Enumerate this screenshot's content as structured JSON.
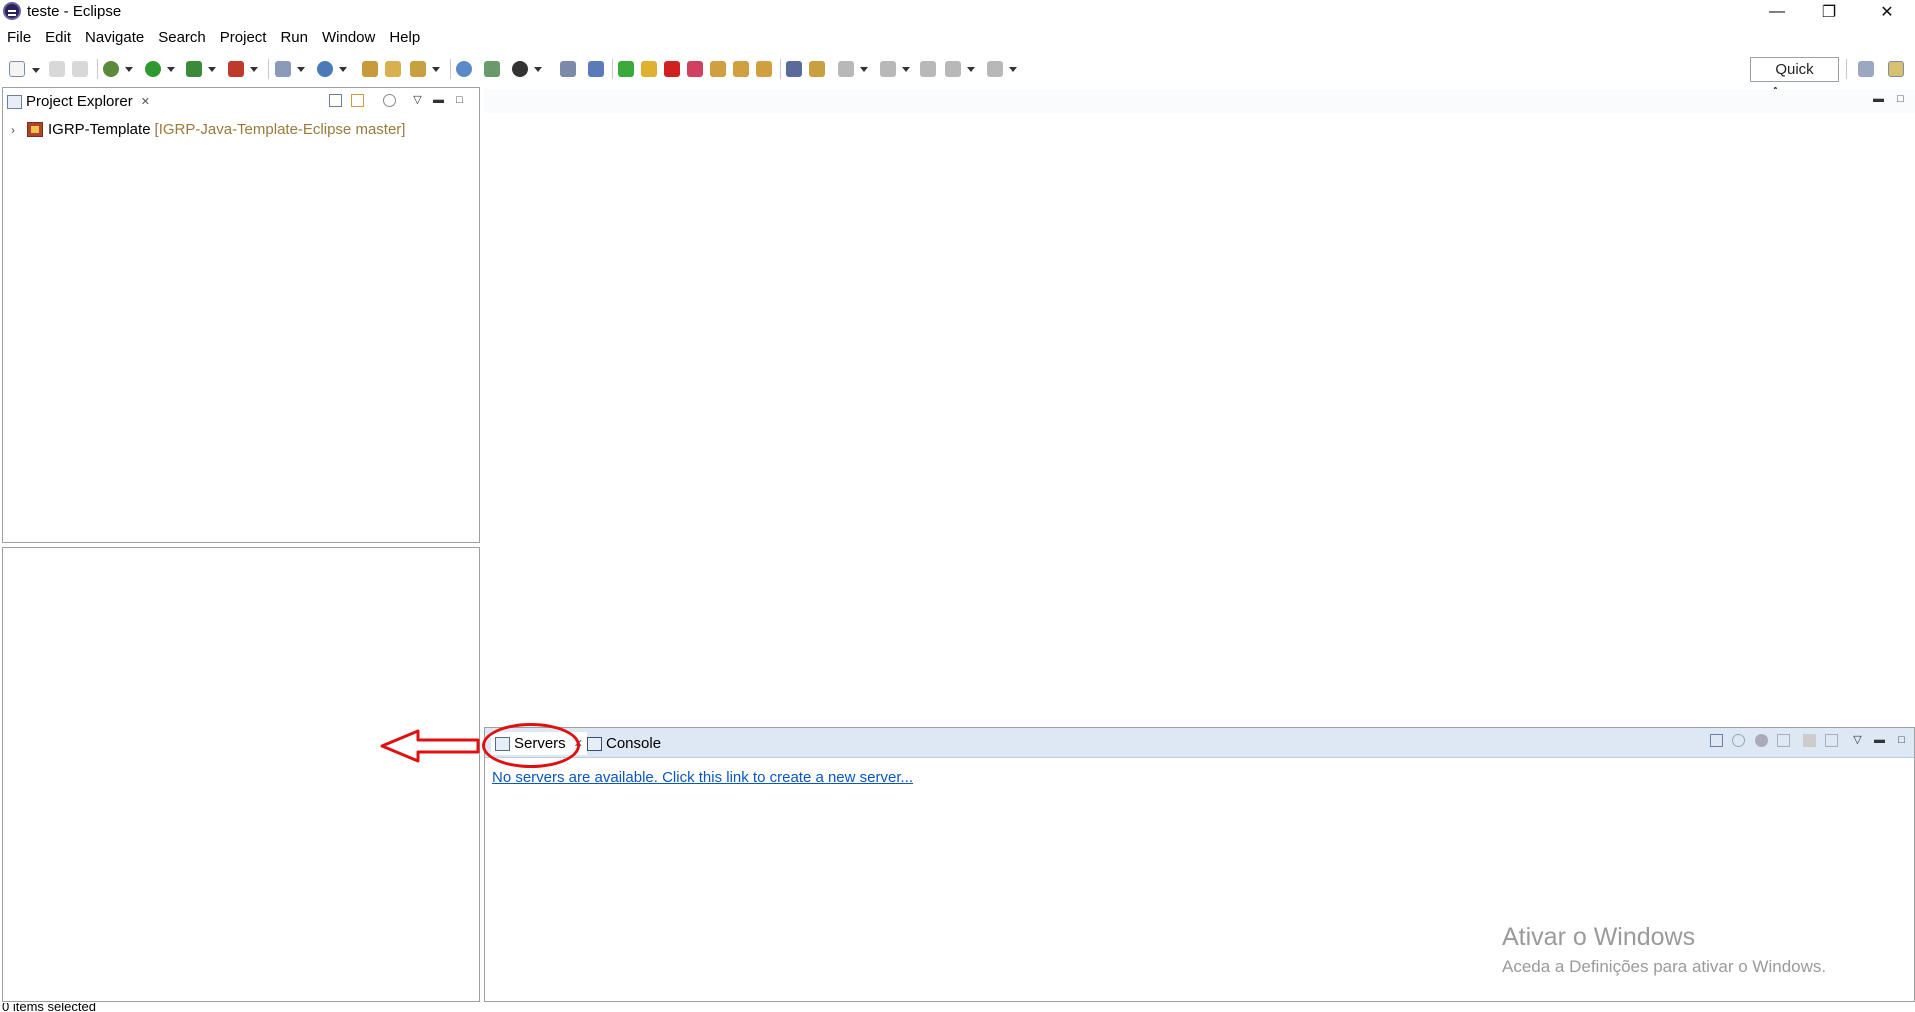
{
  "window": {
    "title": "teste - Eclipse",
    "minimize_symbol": "—",
    "restore_symbol": "❐",
    "close_symbol": "✕"
  },
  "menu": {
    "items": [
      "File",
      "Edit",
      "Navigate",
      "Search",
      "Project",
      "Run",
      "Window",
      "Help"
    ]
  },
  "toolbar": {
    "quick_access": "Quick Access",
    "icons": [
      "new-icon",
      "save-icon",
      "save-all-icon",
      "debug-icon",
      "run-icon",
      "coverage-icon",
      "external-tools-icon",
      "new-server-icon",
      "new-java-class-icon",
      "open-type-icon",
      "open-task-icon",
      "search-icon",
      "globe-icon",
      "git-icon",
      "user-icon",
      "console-icon",
      "skip-breakpoints-icon",
      "resume-icon",
      "suspend-icon",
      "terminate-icon",
      "disconnect-icon",
      "step-into-icon",
      "step-over-icon",
      "step-return-icon",
      "drop-to-frame-icon",
      "use-step-filters-icon",
      "next-annotation-icon",
      "previous-annotation-icon",
      "last-edit-icon",
      "back-icon",
      "forward-icon",
      "open-perspective-icon",
      "java-ee-perspective-icon"
    ]
  },
  "project_explorer": {
    "tab_label": "Project Explorer",
    "close_symbol": "✕",
    "project_name": "IGRP-Template",
    "repo_label": "[IGRP-Java-Template-Eclipse master]",
    "twisty": "›"
  },
  "bottom_panel": {
    "servers_tab": "Servers",
    "console_tab": "Console",
    "close_symbol": "✕",
    "servers_link": "No servers are available. Click this link to create a new server..."
  },
  "watermark": {
    "title": "Ativar o Windows",
    "subtitle": "Aceda a Definições para ativar o Windows."
  },
  "status": {
    "text": "0 items selected"
  },
  "colors": {
    "accent": "#e01010",
    "link": "#0a56c0",
    "panel_header": "#dde8f4"
  }
}
